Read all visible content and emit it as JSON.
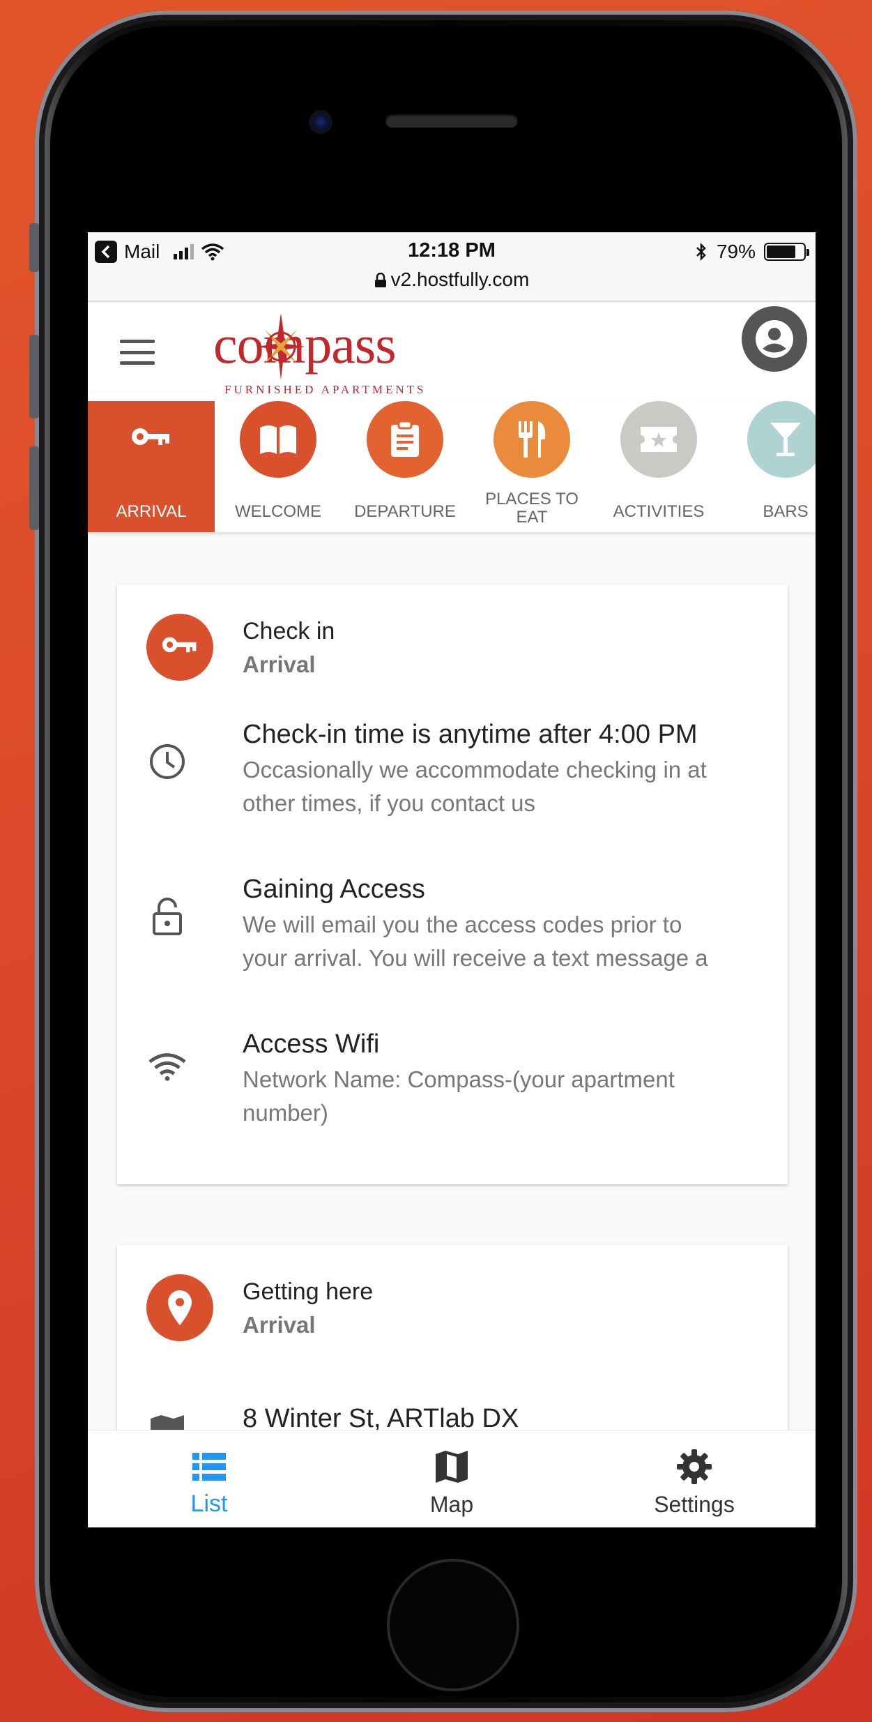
{
  "status_bar": {
    "back_app": "Mail",
    "time": "12:18 PM",
    "url": "v2.hostfully.com",
    "battery": "79%",
    "battery_level": 0.79
  },
  "header": {
    "logo_text": "compass",
    "logo_subtitle": "FURNISHED APARTMENTS"
  },
  "categories": [
    {
      "label": "ARRIVAL",
      "icon": "key-icon",
      "color": "#d9512c",
      "active": true
    },
    {
      "label": "WELCOME",
      "icon": "book-icon",
      "color": "#d9512c",
      "active": false
    },
    {
      "label": "DEPARTURE",
      "icon": "clipboard-icon",
      "color": "#e2632f",
      "active": false
    },
    {
      "label": "PLACES TO EAT",
      "label_line1": "PLACES TO",
      "label_line2": "EAT",
      "icon": "fork-knife-icon",
      "color": "#ea8a3c",
      "active": false
    },
    {
      "label": "ACTIVITIES",
      "icon": "ticket-icon",
      "color": "#c9c9c6",
      "active": false
    },
    {
      "label": "BARS",
      "icon": "cocktail-icon",
      "color": "#aed3d2",
      "active": false
    }
  ],
  "card1": {
    "title": "Check in",
    "subtitle": "Arrival",
    "rows": [
      {
        "icon": "clock-icon",
        "title": "Check-in time is anytime after 4:00 PM",
        "desc_line1": "Occasionally we accommodate checking in at",
        "desc_line2": "other times, if you contact us"
      },
      {
        "icon": "lock-icon",
        "title": "Gaining Access",
        "desc_line1": "We will email you the access codes prior to",
        "desc_line2": "your arrival. You will receive a text message a"
      },
      {
        "icon": "wifi-icon",
        "title": "Access Wifi",
        "desc_line1": "Network Name: Compass-(your apartment",
        "desc_line2": "number)"
      }
    ]
  },
  "card2": {
    "title": "Getting here",
    "subtitle": "Arrival",
    "row_title": "8 Winter St, ARTlab DX"
  },
  "bottom_nav": [
    {
      "label": "List",
      "icon": "list-icon",
      "active": true
    },
    {
      "label": "Map",
      "icon": "map-icon",
      "active": false
    },
    {
      "label": "Settings",
      "icon": "gear-icon",
      "active": false
    }
  ],
  "colors": {
    "brand": "#d9512c",
    "nav_active": "#2196f3"
  }
}
